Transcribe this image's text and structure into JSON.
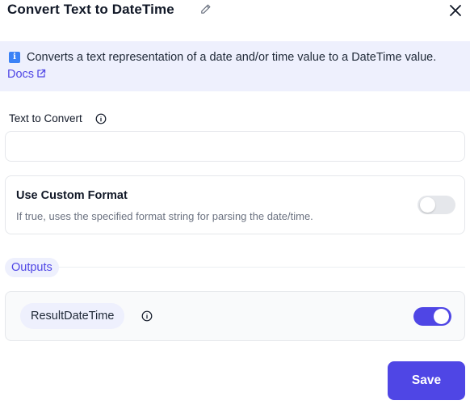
{
  "header": {
    "title": "Convert Text to DateTime",
    "edit_icon": "pencil-icon",
    "close_icon": "close-icon"
  },
  "info_banner": {
    "icon": "info-icon",
    "text": "Converts a text representation of a date and/or time value to a DateTime value.",
    "docs_label": "Docs",
    "docs_icon": "external-link-icon"
  },
  "text_to_convert": {
    "label": "Text to Convert",
    "info_icon": "info-circle-icon",
    "value": "",
    "placeholder": ""
  },
  "custom_format": {
    "title": "Use Custom Format",
    "description": "If true, uses the specified format string for parsing the date/time.",
    "enabled": false
  },
  "outputs": {
    "section_label": "Outputs",
    "items": [
      {
        "name": "ResultDateTime",
        "info_icon": "info-circle-icon",
        "enabled": true
      }
    ]
  },
  "footer": {
    "save_label": "Save"
  },
  "colors": {
    "accent": "#4f46e5",
    "banner_bg": "#eef0fd",
    "info_badge": "#3b82f6"
  }
}
